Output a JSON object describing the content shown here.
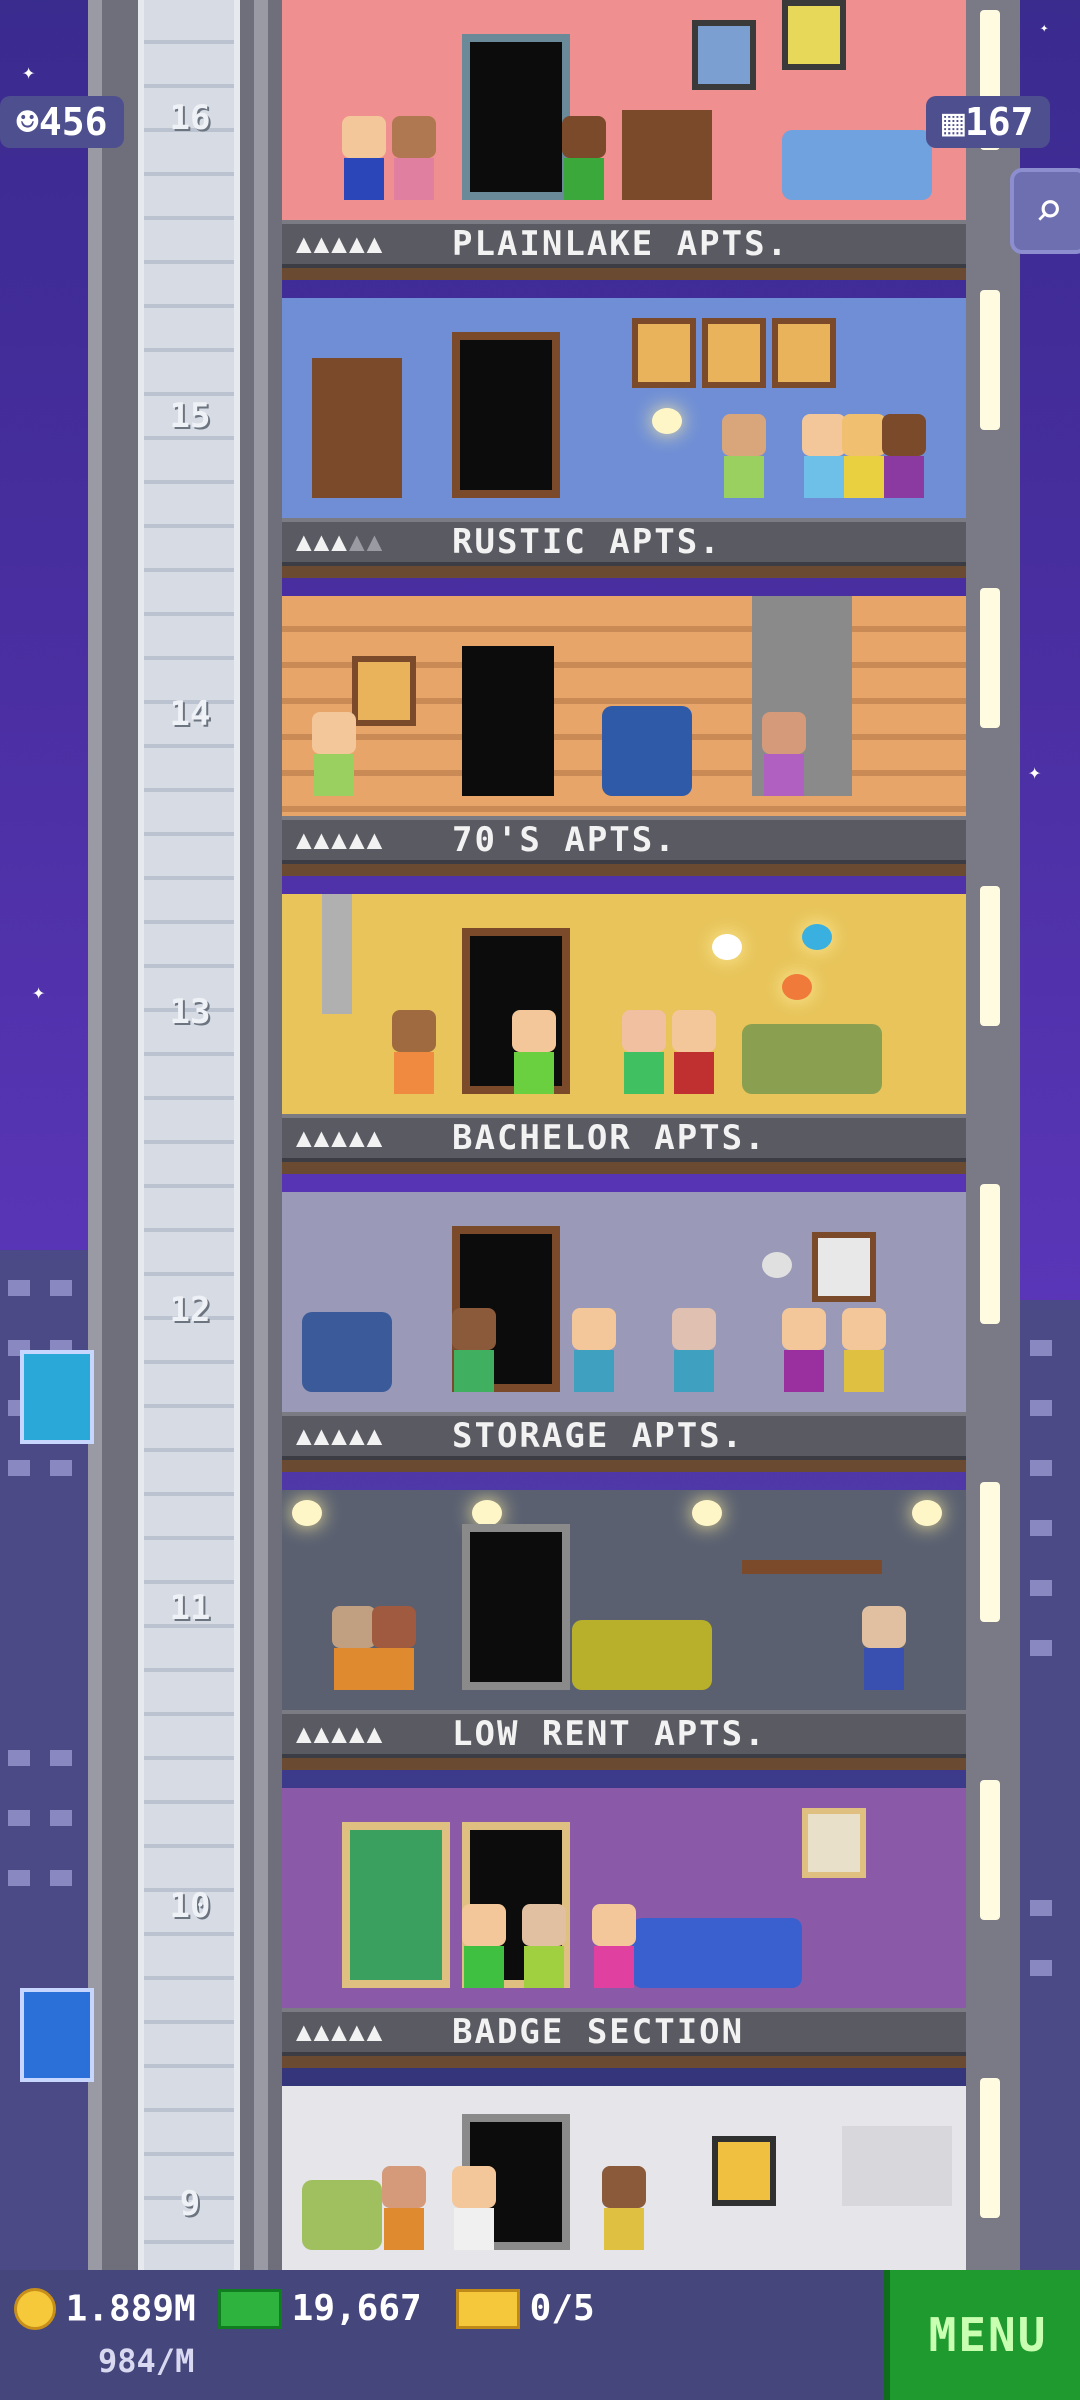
{
  "hud": {
    "population": "456",
    "floors_count": "167",
    "coins": "1.889M",
    "coins_rate": "984/M",
    "bux": "19,667",
    "tickets": "0/5",
    "menu_label": "MENU"
  },
  "colors": {
    "menu": "#1f9a2f",
    "bottom_bar": "#44467c",
    "sky": "#4b2fa3"
  },
  "floors": [
    {
      "number": "16",
      "name": "PLAINLAKE APTS.",
      "stars_filled": 5,
      "stars_text": "▲▲▲▲▲"
    },
    {
      "number": "15",
      "name": "RUSTIC APTS.",
      "stars_filled": 3,
      "stars_text": "▲▲▲",
      "stars_off_text": "▲▲"
    },
    {
      "number": "14",
      "name": "70'S APTS.",
      "stars_filled": 5,
      "stars_text": "▲▲▲▲▲"
    },
    {
      "number": "13",
      "name": "BACHELOR APTS.",
      "stars_filled": 5,
      "stars_text": "▲▲▲▲▲"
    },
    {
      "number": "12",
      "name": "STORAGE APTS.",
      "stars_filled": 5,
      "stars_text": "▲▲▲▲▲"
    },
    {
      "number": "11",
      "name": "LOW RENT APTS.",
      "stars_filled": 5,
      "stars_text": "▲▲▲▲▲"
    },
    {
      "number": "10",
      "name": "BADGE SECTION",
      "stars_filled": 5,
      "stars_text": "▲▲▲▲▲"
    },
    {
      "number": "9",
      "name": "",
      "stars_filled": 0,
      "stars_text": ""
    }
  ],
  "icons": {
    "population": "person-icon",
    "floors": "building-icon",
    "search": "magnifier-icon",
    "coins": "coin-icon",
    "bux": "bux-icon",
    "tickets": "ticket-icon",
    "left_notification_1": "food-icon",
    "left_notification_2": "document-icon"
  }
}
